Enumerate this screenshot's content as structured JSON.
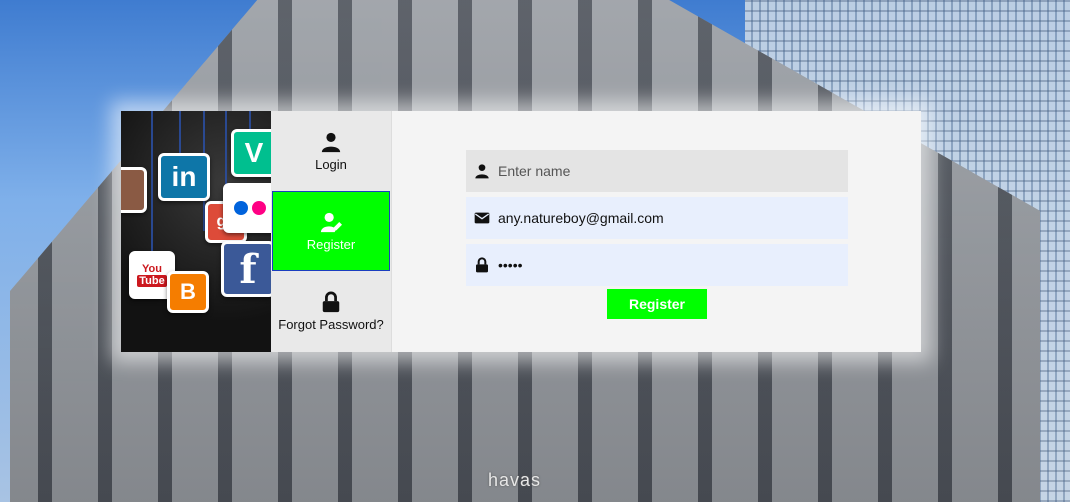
{
  "background": {
    "sign_text": "havas"
  },
  "hero": {
    "tiles": {
      "linkedin": "in",
      "vine": "V",
      "youtube_top": "You",
      "youtube_bottom": "Tube",
      "facebook": "f",
      "blogger": "B",
      "gplus": "g+"
    }
  },
  "tabs": [
    {
      "label": "Login",
      "icon": "user-icon",
      "active": false
    },
    {
      "label": "Register",
      "icon": "user-edit-icon",
      "active": true
    },
    {
      "label": "Forgot Password?",
      "icon": "lock-icon",
      "active": false
    }
  ],
  "form": {
    "name": {
      "placeholder": "Enter name",
      "value": "",
      "icon": "user-icon"
    },
    "email": {
      "placeholder": "",
      "value": "any.natureboy@gmail.com",
      "icon": "envelope-icon"
    },
    "password": {
      "placeholder": "",
      "value": "•••••",
      "icon": "lock-icon"
    },
    "submit_label": "Register"
  },
  "colors": {
    "accent": "#00ff00",
    "active_border": "#1a3dbf"
  }
}
